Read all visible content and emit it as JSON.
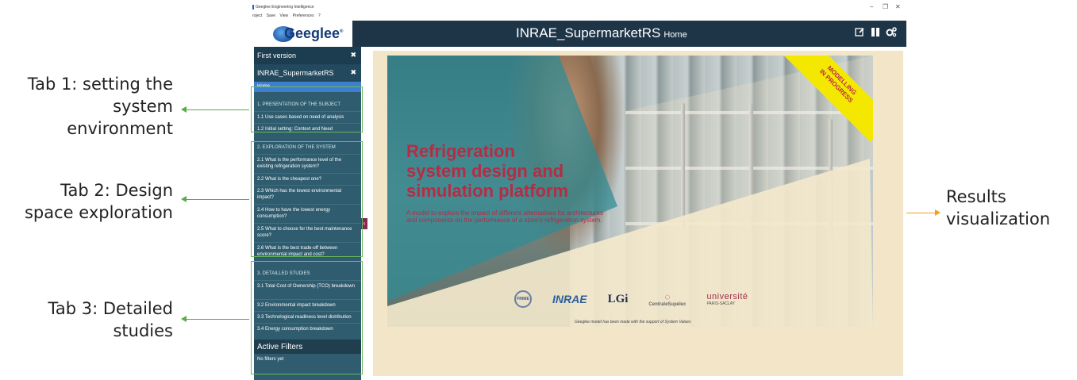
{
  "annotations": {
    "tab1": "Tab 1: setting the system environment",
    "tab1_lines": [
      "Tab 1: setting the",
      "system",
      "environment"
    ],
    "tab2_lines": [
      "Tab 2: Design",
      "space exploration"
    ],
    "tab3_lines": [
      "Tab 3: Detailed",
      "studies"
    ],
    "results_lines": [
      "Results",
      "visualization"
    ]
  },
  "window": {
    "title": "Geeglee Engineering Intelligence",
    "menu": [
      "roject",
      "Save",
      "View",
      "Preferences",
      "?"
    ],
    "controls": [
      "–",
      "❐",
      "✕"
    ]
  },
  "header": {
    "logo_text": "Geeglee",
    "logo_tm": "®",
    "project_title": "INRAE_SupermarketRS",
    "page_label": "Home",
    "icons": [
      "edit-icon",
      "columns-icon",
      "settings-icon"
    ]
  },
  "sidebar": {
    "versions": [
      {
        "label": "First version",
        "close": "✖"
      },
      {
        "label": "INRAE_SupermarketRS",
        "close": "✖"
      }
    ],
    "home": "Home",
    "sections": [
      {
        "title": "1. PRESENTATION OF THE SUBJECT",
        "items": [
          "1.1 Use cases based on need of analysis",
          "1.2 Initial setting: Context and Need"
        ]
      },
      {
        "title": "2. EXPLORATION OF THE SYSTEM",
        "items": [
          "2.1 What is the performance level of the existing refrigeration system?",
          "2.2 What is the cheapest one?",
          "2.3 Which has the lowest environmental impact?",
          "2.4 How to have the lowest energy consumption?",
          "2.5 What to choose for the best maintenance score?",
          "2.6 What is the best trade-off between environmental impact and cost?"
        ]
      },
      {
        "title": "3. DETAILLED STUDIES",
        "items": [
          "3.1 Total Cost of Ownership (TCO) breakdown",
          "3.2 Environmental impact breakdown",
          "3.3 Technological readiness level distribution",
          "3.4 Energy consumption breakdown"
        ]
      }
    ],
    "filters_title": "Active Filters",
    "filters_empty": "No filters yet",
    "collapse_glyph": "‹"
  },
  "hero": {
    "title_lines": [
      "Refrigeration",
      "system design and",
      "simulation platform"
    ],
    "description": "A model to explore the impact of different alternatives for architectures and components on the performance of a store's refrigeration system.",
    "ribbon_lines": [
      "MODELLING",
      "IN PROGRESS"
    ],
    "logos": {
      "frime": "FRIME",
      "inrae": "INRAE",
      "lgi": "LGi",
      "cs": "CentraleSupélec",
      "ups": "université",
      "ups_sub": "PARIS-SACLAY"
    },
    "support_note": "Geeglee model has been made with the support of System Values"
  },
  "colors": {
    "header_bg": "#1d3547",
    "sidebar_bg": "#2f5c6e",
    "accent_red": "#b52c45",
    "ribbon_yellow": "#f5e800",
    "content_bg": "#f3e6c8",
    "annotation_green": "#6aba5a",
    "annotation_orange": "#f0a020"
  }
}
